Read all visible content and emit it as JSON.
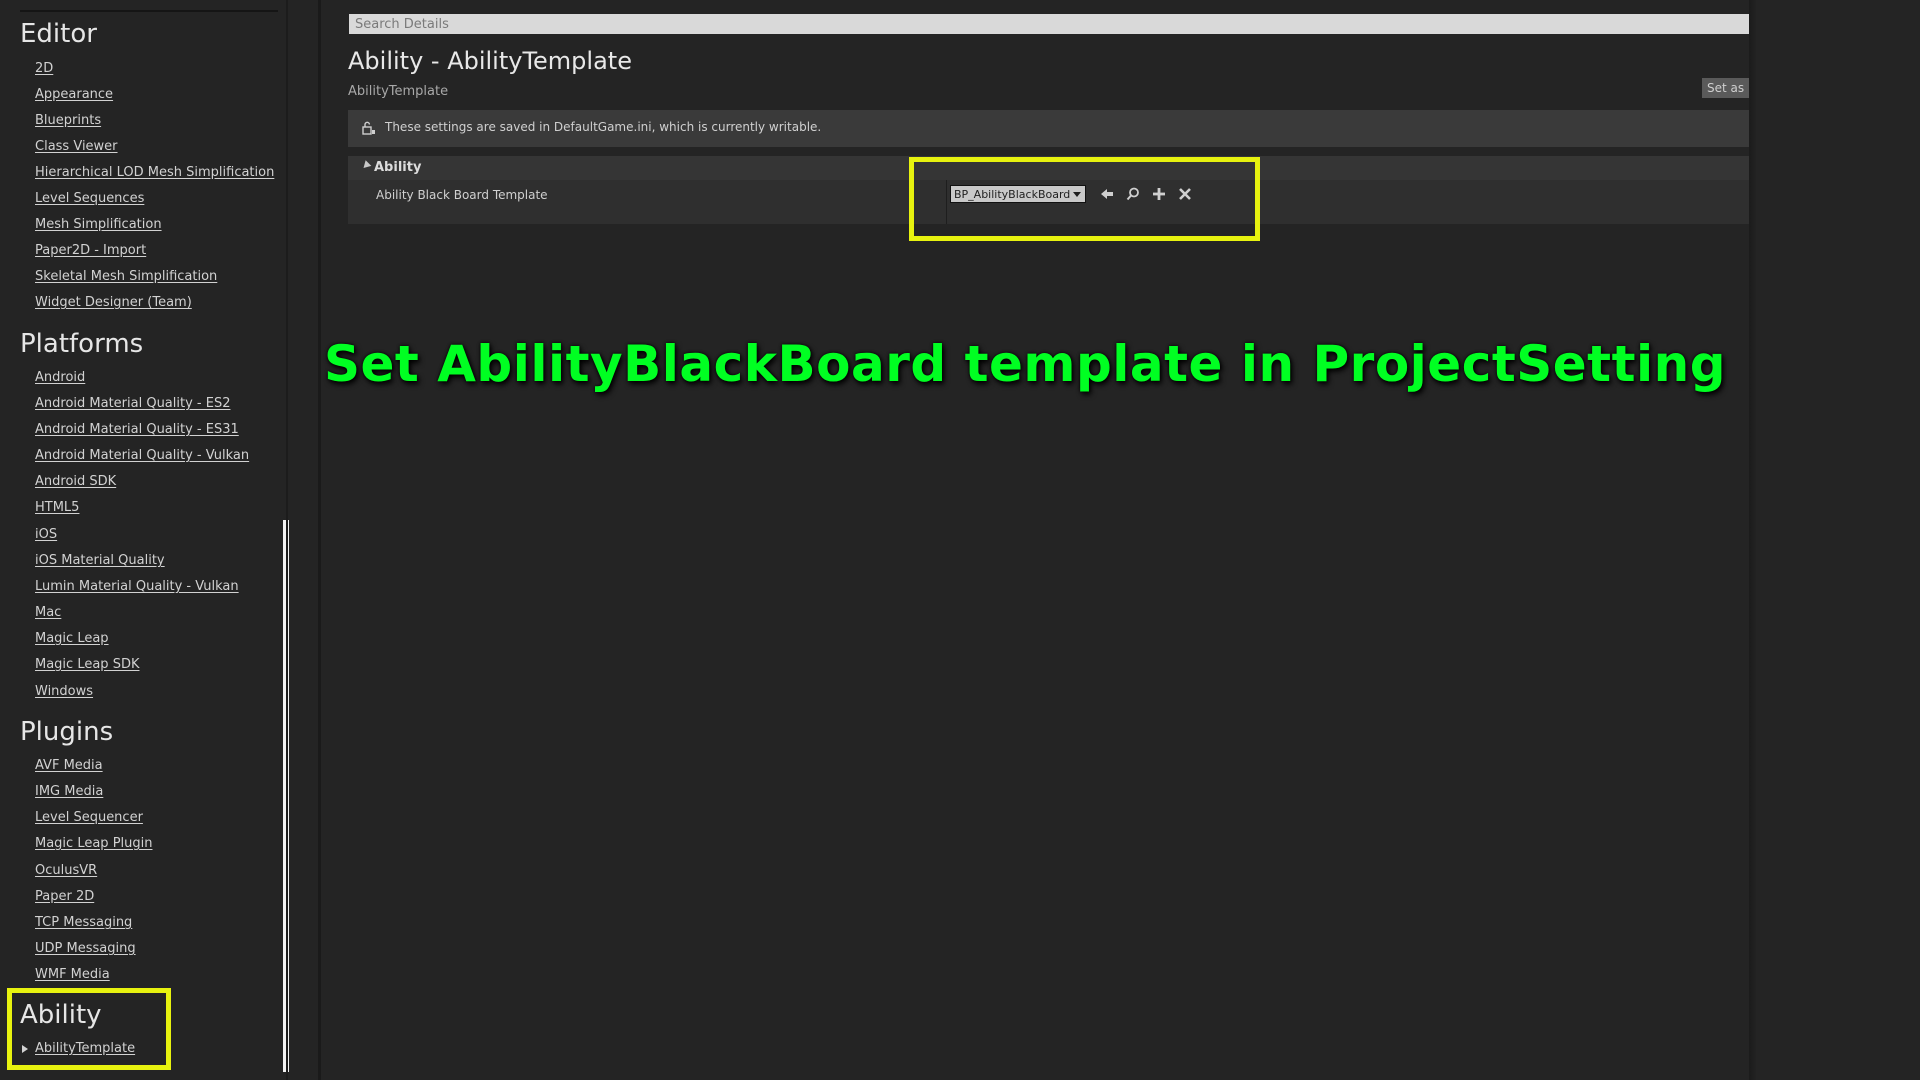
{
  "sidebar": {
    "sections": [
      {
        "title": "Editor",
        "items": [
          "2D",
          "Appearance",
          "Blueprints",
          "Class Viewer",
          "Hierarchical LOD Mesh Simplification",
          "Level Sequences",
          "Mesh Simplification",
          "Paper2D - Import",
          "Skeletal Mesh Simplification",
          "Widget Designer (Team)"
        ]
      },
      {
        "title": "Platforms",
        "items": [
          "Android",
          "Android Material Quality - ES2",
          "Android Material Quality - ES31",
          "Android Material Quality - Vulkan",
          "Android SDK",
          "HTML5",
          "iOS",
          "iOS Material Quality",
          "Lumin Material Quality - Vulkan",
          "Mac",
          "Magic Leap",
          "Magic Leap SDK",
          "Windows"
        ]
      },
      {
        "title": "Plugins",
        "items": [
          "AVF Media",
          "IMG Media",
          "Level Sequencer",
          "Magic Leap Plugin",
          "OculusVR",
          "Paper 2D",
          "TCP Messaging",
          "UDP Messaging",
          "WMF Media"
        ]
      },
      {
        "title": "Ability",
        "items": [
          "AbilityTemplate"
        ]
      }
    ]
  },
  "details": {
    "search_placeholder": "Search Details",
    "title": "Ability - AbilityTemplate",
    "subtitle": "AbilityTemplate",
    "set_default_label": "Set as D",
    "info_text": "These settings are saved in DefaultGame.ini, which is currently writable.",
    "category": "Ability",
    "property": {
      "label": "Ability Black Board Template",
      "value": "BP_AbilityBlackBoard"
    }
  },
  "annotation": {
    "text": "Set AbilityBlackBoard template in ProjectSetting"
  },
  "colors": {
    "highlight": "#e7f20f",
    "annotation": "#00ff22"
  }
}
